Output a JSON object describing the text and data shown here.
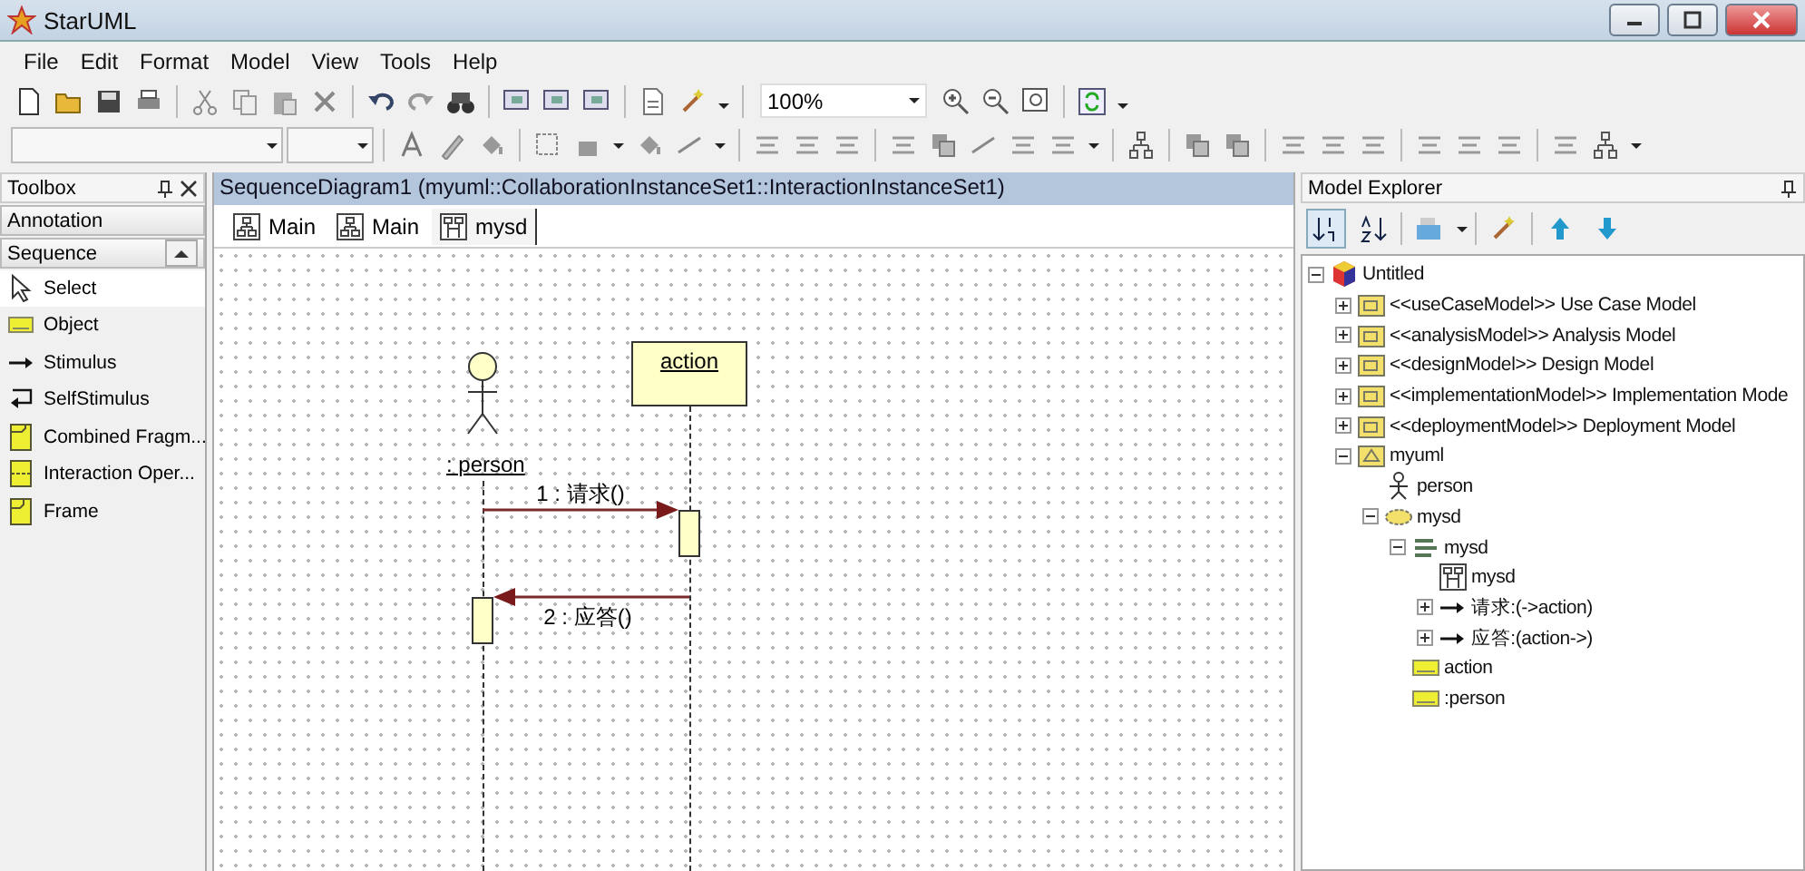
{
  "window": {
    "title": "StarUML"
  },
  "menu": [
    "File",
    "Edit",
    "Format",
    "Model",
    "View",
    "Tools",
    "Help"
  ],
  "toolbar": {
    "zoom": "100%"
  },
  "toolbox": {
    "title": "Toolbox",
    "groups": [
      {
        "label": "Annotation",
        "expanded": false
      },
      {
        "label": "Sequence",
        "expanded": true,
        "items": [
          {
            "label": "Select",
            "kind": "pointer",
            "selected": true
          },
          {
            "label": "Object",
            "kind": "object",
            "selected": false
          },
          {
            "label": "Stimulus",
            "kind": "arrow",
            "selected": false
          },
          {
            "label": "SelfStimulus",
            "kind": "self-arrow",
            "selected": false
          },
          {
            "label": "Combined Fragm...",
            "kind": "fragment",
            "selected": false
          },
          {
            "label": "Interaction Oper...",
            "kind": "operand",
            "selected": false
          },
          {
            "label": "Frame",
            "kind": "frame",
            "selected": false
          }
        ]
      }
    ]
  },
  "diagram": {
    "title": "SequenceDiagram1 (myuml::CollaborationInstanceSet1::InteractionInstanceSet1)",
    "tabs": [
      {
        "label": "Main",
        "kind": "class",
        "selected": false
      },
      {
        "label": "Main",
        "kind": "class",
        "selected": false
      },
      {
        "label": "mysd",
        "kind": "sequence",
        "selected": true
      }
    ],
    "lifelines": [
      {
        "name": ": person",
        "kind": "actor"
      },
      {
        "name": "action",
        "kind": "object"
      }
    ],
    "messages": [
      {
        "label": "1 : 请求()",
        "kind": "forward"
      },
      {
        "label": "2 : 应答()",
        "kind": "return"
      }
    ]
  },
  "explorer": {
    "title": "Model Explorer",
    "tree": [
      {
        "label": "Untitled",
        "kind": "project",
        "expanded": true,
        "children": [
          {
            "label": "<<useCaseModel>> Use Case Model",
            "kind": "model",
            "expanded": false
          },
          {
            "label": "<<analysisModel>> Analysis Model",
            "kind": "model",
            "expanded": false
          },
          {
            "label": "<<designModel>> Design Model",
            "kind": "model",
            "expanded": false
          },
          {
            "label": "<<implementationModel>> Implementation Mode",
            "kind": "model",
            "expanded": false
          },
          {
            "label": "<<deploymentModel>> Deployment Model",
            "kind": "model",
            "expanded": false
          },
          {
            "label": "myuml",
            "kind": "package",
            "expanded": true,
            "children": [
              {
                "label": "person",
                "kind": "actor"
              },
              {
                "label": "mysd",
                "kind": "collaboration",
                "expanded": true,
                "children": [
                  {
                    "label": "mysd",
                    "kind": "interaction",
                    "expanded": true,
                    "children": [
                      {
                        "label": "mysd",
                        "kind": "diagram"
                      },
                      {
                        "label": "请求:(->action)",
                        "kind": "stimulus",
                        "expanded": false
                      },
                      {
                        "label": "应答:(action->)",
                        "kind": "stimulus",
                        "expanded": false
                      }
                    ]
                  },
                  {
                    "label": "action",
                    "kind": "object"
                  },
                  {
                    "label": ":person",
                    "kind": "object"
                  }
                ]
              }
            ]
          }
        ]
      }
    ]
  }
}
